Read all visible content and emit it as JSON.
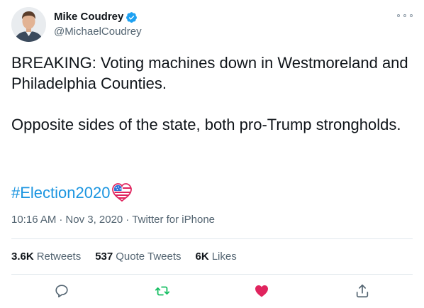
{
  "tweet": {
    "author": {
      "display_name": "Mike Coudrey",
      "handle": "@MichaelCoudrey",
      "verified": true,
      "verified_color": "#1da1f2"
    },
    "text_paragraphs": [
      "BREAKING: Voting machines down in Westmoreland and Philadelphia Counties.",
      "Opposite sides of the state, both pro-Trump strongholds."
    ],
    "hashtag": "#Election2020",
    "hashtag_color": "#1b95e0",
    "time": "10:16 AM",
    "date": "Nov 3, 2020",
    "source": "Twitter for iPhone",
    "meta_separator": "·",
    "stats": {
      "retweets_count": "3.6K",
      "retweets_label": "Retweets",
      "quote_tweets_count": "537",
      "quote_tweets_label": "Quote Tweets",
      "likes_count": "6K",
      "likes_label": "Likes"
    },
    "actions": {
      "reply_icon": "reply-icon",
      "retweet_icon": "retweet-icon",
      "retweet_color": "#17bf63",
      "like_icon": "heart-icon",
      "like_color": "#e0245e",
      "liked": true,
      "share_icon": "share-icon"
    }
  }
}
